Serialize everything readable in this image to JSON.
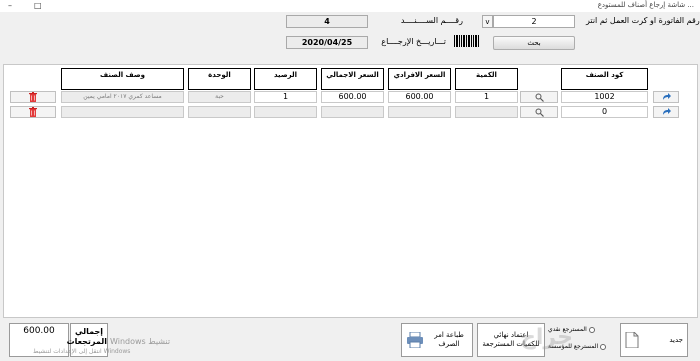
{
  "titlebar": {
    "title": "... شاشة إرجاع أصناف للمستودع",
    "minimize": "–",
    "maximize": "□"
  },
  "header": {
    "invoice_prompt": "ادخل رقم الفاتورة او كرت العمل ثم انتر",
    "invoice_number": "2",
    "serial_label": "رقــــم الســــنــــد",
    "serial_value": "4",
    "return_date_label": "تـــاريـــخ الإرجــــاع",
    "return_date_value": "2020/04/25",
    "search_button": "بحث",
    "combo_arrow": "v"
  },
  "table": {
    "columns": [
      "كود الصنف",
      "الكمية",
      "السعر الافرادي",
      "السعر الاجمالي",
      "الرصيد",
      "الوحدة",
      "وصف الصنف"
    ],
    "rows": [
      {
        "code": "1002",
        "qty": "1",
        "unit_price": "600.00",
        "total_price": "600.00",
        "balance": "1",
        "unit": "حبة",
        "description": "مساعد كمري ٢٠١٧ امامي يمين"
      },
      {
        "code": "0",
        "qty": "",
        "unit_price": "",
        "total_price": "",
        "balance": "",
        "unit": "",
        "description": ""
      }
    ]
  },
  "footer": {
    "total_value": "600.00",
    "total_label": "إجمالي المرتجعات",
    "print_button": "طباعة امر الصرف",
    "confirm_button": "اعتماد نهائي للكميات المسترجعة",
    "new_button": "جديد",
    "radio_cash": "المسترجع نقدي",
    "radio_account": "المسترجع للمؤسسة",
    "watermark_line1": "تنشيط Windows",
    "watermark_line2": "انتقل إلى الإعدادات لتنشيط Windows",
    "logo_watermark": "حراج"
  }
}
